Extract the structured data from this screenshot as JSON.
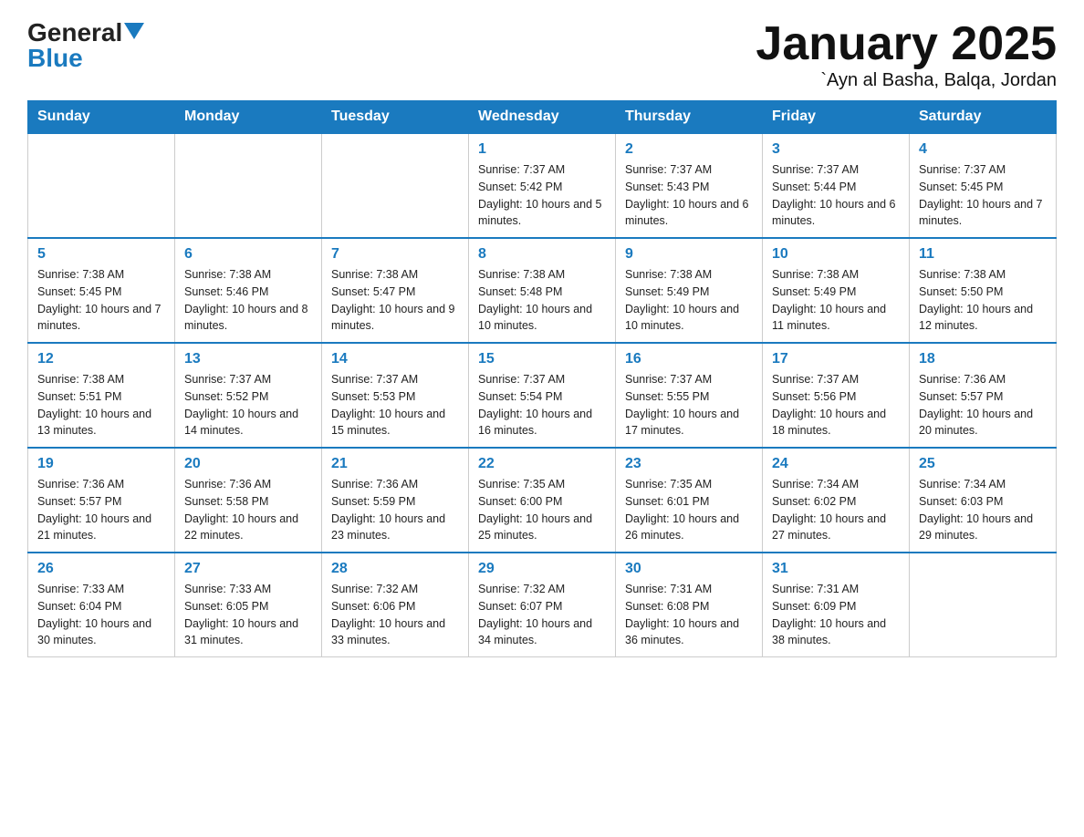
{
  "logo": {
    "general": "General",
    "blue": "Blue"
  },
  "title": "January 2025",
  "location": "`Ayn al Basha, Balqa, Jordan",
  "days_of_week": [
    "Sunday",
    "Monday",
    "Tuesday",
    "Wednesday",
    "Thursday",
    "Friday",
    "Saturday"
  ],
  "weeks": [
    [
      {
        "day": "",
        "info": ""
      },
      {
        "day": "",
        "info": ""
      },
      {
        "day": "",
        "info": ""
      },
      {
        "day": "1",
        "info": "Sunrise: 7:37 AM\nSunset: 5:42 PM\nDaylight: 10 hours and 5 minutes."
      },
      {
        "day": "2",
        "info": "Sunrise: 7:37 AM\nSunset: 5:43 PM\nDaylight: 10 hours and 6 minutes."
      },
      {
        "day": "3",
        "info": "Sunrise: 7:37 AM\nSunset: 5:44 PM\nDaylight: 10 hours and 6 minutes."
      },
      {
        "day": "4",
        "info": "Sunrise: 7:37 AM\nSunset: 5:45 PM\nDaylight: 10 hours and 7 minutes."
      }
    ],
    [
      {
        "day": "5",
        "info": "Sunrise: 7:38 AM\nSunset: 5:45 PM\nDaylight: 10 hours and 7 minutes."
      },
      {
        "day": "6",
        "info": "Sunrise: 7:38 AM\nSunset: 5:46 PM\nDaylight: 10 hours and 8 minutes."
      },
      {
        "day": "7",
        "info": "Sunrise: 7:38 AM\nSunset: 5:47 PM\nDaylight: 10 hours and 9 minutes."
      },
      {
        "day": "8",
        "info": "Sunrise: 7:38 AM\nSunset: 5:48 PM\nDaylight: 10 hours and 10 minutes."
      },
      {
        "day": "9",
        "info": "Sunrise: 7:38 AM\nSunset: 5:49 PM\nDaylight: 10 hours and 10 minutes."
      },
      {
        "day": "10",
        "info": "Sunrise: 7:38 AM\nSunset: 5:49 PM\nDaylight: 10 hours and 11 minutes."
      },
      {
        "day": "11",
        "info": "Sunrise: 7:38 AM\nSunset: 5:50 PM\nDaylight: 10 hours and 12 minutes."
      }
    ],
    [
      {
        "day": "12",
        "info": "Sunrise: 7:38 AM\nSunset: 5:51 PM\nDaylight: 10 hours and 13 minutes."
      },
      {
        "day": "13",
        "info": "Sunrise: 7:37 AM\nSunset: 5:52 PM\nDaylight: 10 hours and 14 minutes."
      },
      {
        "day": "14",
        "info": "Sunrise: 7:37 AM\nSunset: 5:53 PM\nDaylight: 10 hours and 15 minutes."
      },
      {
        "day": "15",
        "info": "Sunrise: 7:37 AM\nSunset: 5:54 PM\nDaylight: 10 hours and 16 minutes."
      },
      {
        "day": "16",
        "info": "Sunrise: 7:37 AM\nSunset: 5:55 PM\nDaylight: 10 hours and 17 minutes."
      },
      {
        "day": "17",
        "info": "Sunrise: 7:37 AM\nSunset: 5:56 PM\nDaylight: 10 hours and 18 minutes."
      },
      {
        "day": "18",
        "info": "Sunrise: 7:36 AM\nSunset: 5:57 PM\nDaylight: 10 hours and 20 minutes."
      }
    ],
    [
      {
        "day": "19",
        "info": "Sunrise: 7:36 AM\nSunset: 5:57 PM\nDaylight: 10 hours and 21 minutes."
      },
      {
        "day": "20",
        "info": "Sunrise: 7:36 AM\nSunset: 5:58 PM\nDaylight: 10 hours and 22 minutes."
      },
      {
        "day": "21",
        "info": "Sunrise: 7:36 AM\nSunset: 5:59 PM\nDaylight: 10 hours and 23 minutes."
      },
      {
        "day": "22",
        "info": "Sunrise: 7:35 AM\nSunset: 6:00 PM\nDaylight: 10 hours and 25 minutes."
      },
      {
        "day": "23",
        "info": "Sunrise: 7:35 AM\nSunset: 6:01 PM\nDaylight: 10 hours and 26 minutes."
      },
      {
        "day": "24",
        "info": "Sunrise: 7:34 AM\nSunset: 6:02 PM\nDaylight: 10 hours and 27 minutes."
      },
      {
        "day": "25",
        "info": "Sunrise: 7:34 AM\nSunset: 6:03 PM\nDaylight: 10 hours and 29 minutes."
      }
    ],
    [
      {
        "day": "26",
        "info": "Sunrise: 7:33 AM\nSunset: 6:04 PM\nDaylight: 10 hours and 30 minutes."
      },
      {
        "day": "27",
        "info": "Sunrise: 7:33 AM\nSunset: 6:05 PM\nDaylight: 10 hours and 31 minutes."
      },
      {
        "day": "28",
        "info": "Sunrise: 7:32 AM\nSunset: 6:06 PM\nDaylight: 10 hours and 33 minutes."
      },
      {
        "day": "29",
        "info": "Sunrise: 7:32 AM\nSunset: 6:07 PM\nDaylight: 10 hours and 34 minutes."
      },
      {
        "day": "30",
        "info": "Sunrise: 7:31 AM\nSunset: 6:08 PM\nDaylight: 10 hours and 36 minutes."
      },
      {
        "day": "31",
        "info": "Sunrise: 7:31 AM\nSunset: 6:09 PM\nDaylight: 10 hours and 38 minutes."
      },
      {
        "day": "",
        "info": ""
      }
    ]
  ]
}
